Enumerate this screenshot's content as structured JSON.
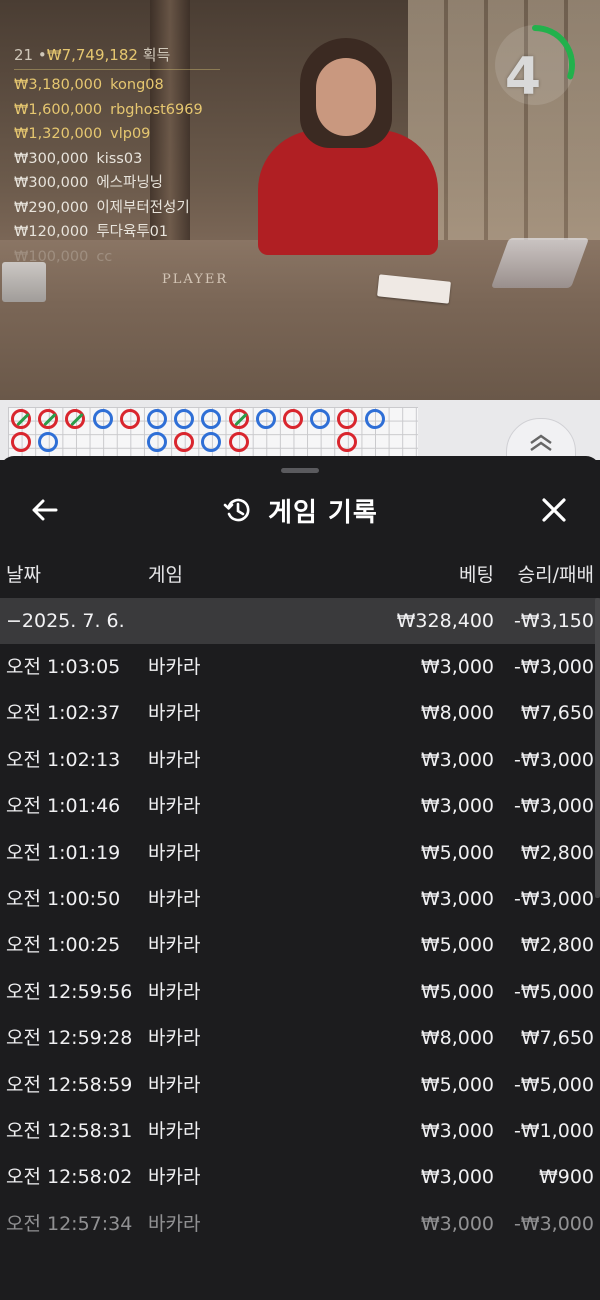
{
  "stream": {
    "table_label": "PLAYER",
    "countdown": "4",
    "countdown_fraction": 0.3,
    "winners": {
      "count": "21",
      "total": "₩7,749,182",
      "suffix": "획득",
      "entries": [
        {
          "amount": "₩3,180,000",
          "name": "kong08",
          "highlight": true
        },
        {
          "amount": "₩1,600,000",
          "name": "rbghost6969",
          "highlight": true
        },
        {
          "amount": "₩1,320,000",
          "name": "vlp09",
          "highlight": true
        },
        {
          "amount": "₩300,000",
          "name": "kiss03",
          "highlight": false
        },
        {
          "amount": "₩300,000",
          "name": "에스파닝닝",
          "highlight": false
        },
        {
          "amount": "₩290,000",
          "name": "이제부터전성기",
          "highlight": false
        },
        {
          "amount": "₩120,000",
          "name": "투다육투01",
          "highlight": false
        },
        {
          "amount": "₩100,000",
          "name": "cc",
          "highlight": false,
          "faded": true
        }
      ]
    }
  },
  "roadmap": {
    "colors": {
      "banker": "#d9262e",
      "player": "#2f6fd6",
      "tie": "#2a9d4a"
    },
    "columns": [
      [
        "r-t",
        "r"
      ],
      [
        "r-t",
        "b"
      ],
      [
        "r-t"
      ],
      [
        "b"
      ],
      [
        "r"
      ],
      [
        "b",
        "b"
      ],
      [
        "b",
        "r"
      ],
      [
        "b",
        "b"
      ],
      [
        "r-t",
        "r"
      ],
      [
        "b"
      ],
      [
        "r"
      ],
      [
        "b"
      ],
      [
        "r",
        "r"
      ],
      [
        "b"
      ]
    ]
  },
  "sheet": {
    "title": "게임 기록",
    "columns": {
      "date": "날짜",
      "game": "게임",
      "bet": "베팅",
      "result": "승리/패배"
    },
    "summary": {
      "date": "−2025. 7. 6.",
      "bet": "₩328,400",
      "result": "-₩3,150"
    },
    "rows": [
      {
        "time": "오전 1:03:05",
        "game": "바카라",
        "bet": "₩3,000",
        "result": "-₩3,000"
      },
      {
        "time": "오전 1:02:37",
        "game": "바카라",
        "bet": "₩8,000",
        "result": "₩7,650"
      },
      {
        "time": "오전 1:02:13",
        "game": "바카라",
        "bet": "₩3,000",
        "result": "-₩3,000"
      },
      {
        "time": "오전 1:01:46",
        "game": "바카라",
        "bet": "₩3,000",
        "result": "-₩3,000"
      },
      {
        "time": "오전 1:01:19",
        "game": "바카라",
        "bet": "₩5,000",
        "result": "₩2,800"
      },
      {
        "time": "오전 1:00:50",
        "game": "바카라",
        "bet": "₩3,000",
        "result": "-₩3,000"
      },
      {
        "time": "오전 1:00:25",
        "game": "바카라",
        "bet": "₩5,000",
        "result": "₩2,800"
      },
      {
        "time": "오전 12:59:56",
        "game": "바카라",
        "bet": "₩5,000",
        "result": "-₩5,000"
      },
      {
        "time": "오전 12:59:28",
        "game": "바카라",
        "bet": "₩8,000",
        "result": "₩7,650"
      },
      {
        "time": "오전 12:58:59",
        "game": "바카라",
        "bet": "₩5,000",
        "result": "-₩5,000"
      },
      {
        "time": "오전 12:58:31",
        "game": "바카라",
        "bet": "₩3,000",
        "result": "-₩1,000"
      },
      {
        "time": "오전 12:58:02",
        "game": "바카라",
        "bet": "₩3,000",
        "result": "₩900"
      },
      {
        "time": "오전 12:57:34",
        "game": "바카라",
        "bet": "₩3,000",
        "result": "-₩3,000"
      }
    ]
  },
  "icons": {
    "back": "arrow-left-icon",
    "history": "history-clock-icon",
    "close": "close-icon",
    "expand": "chevron-up-icon"
  }
}
